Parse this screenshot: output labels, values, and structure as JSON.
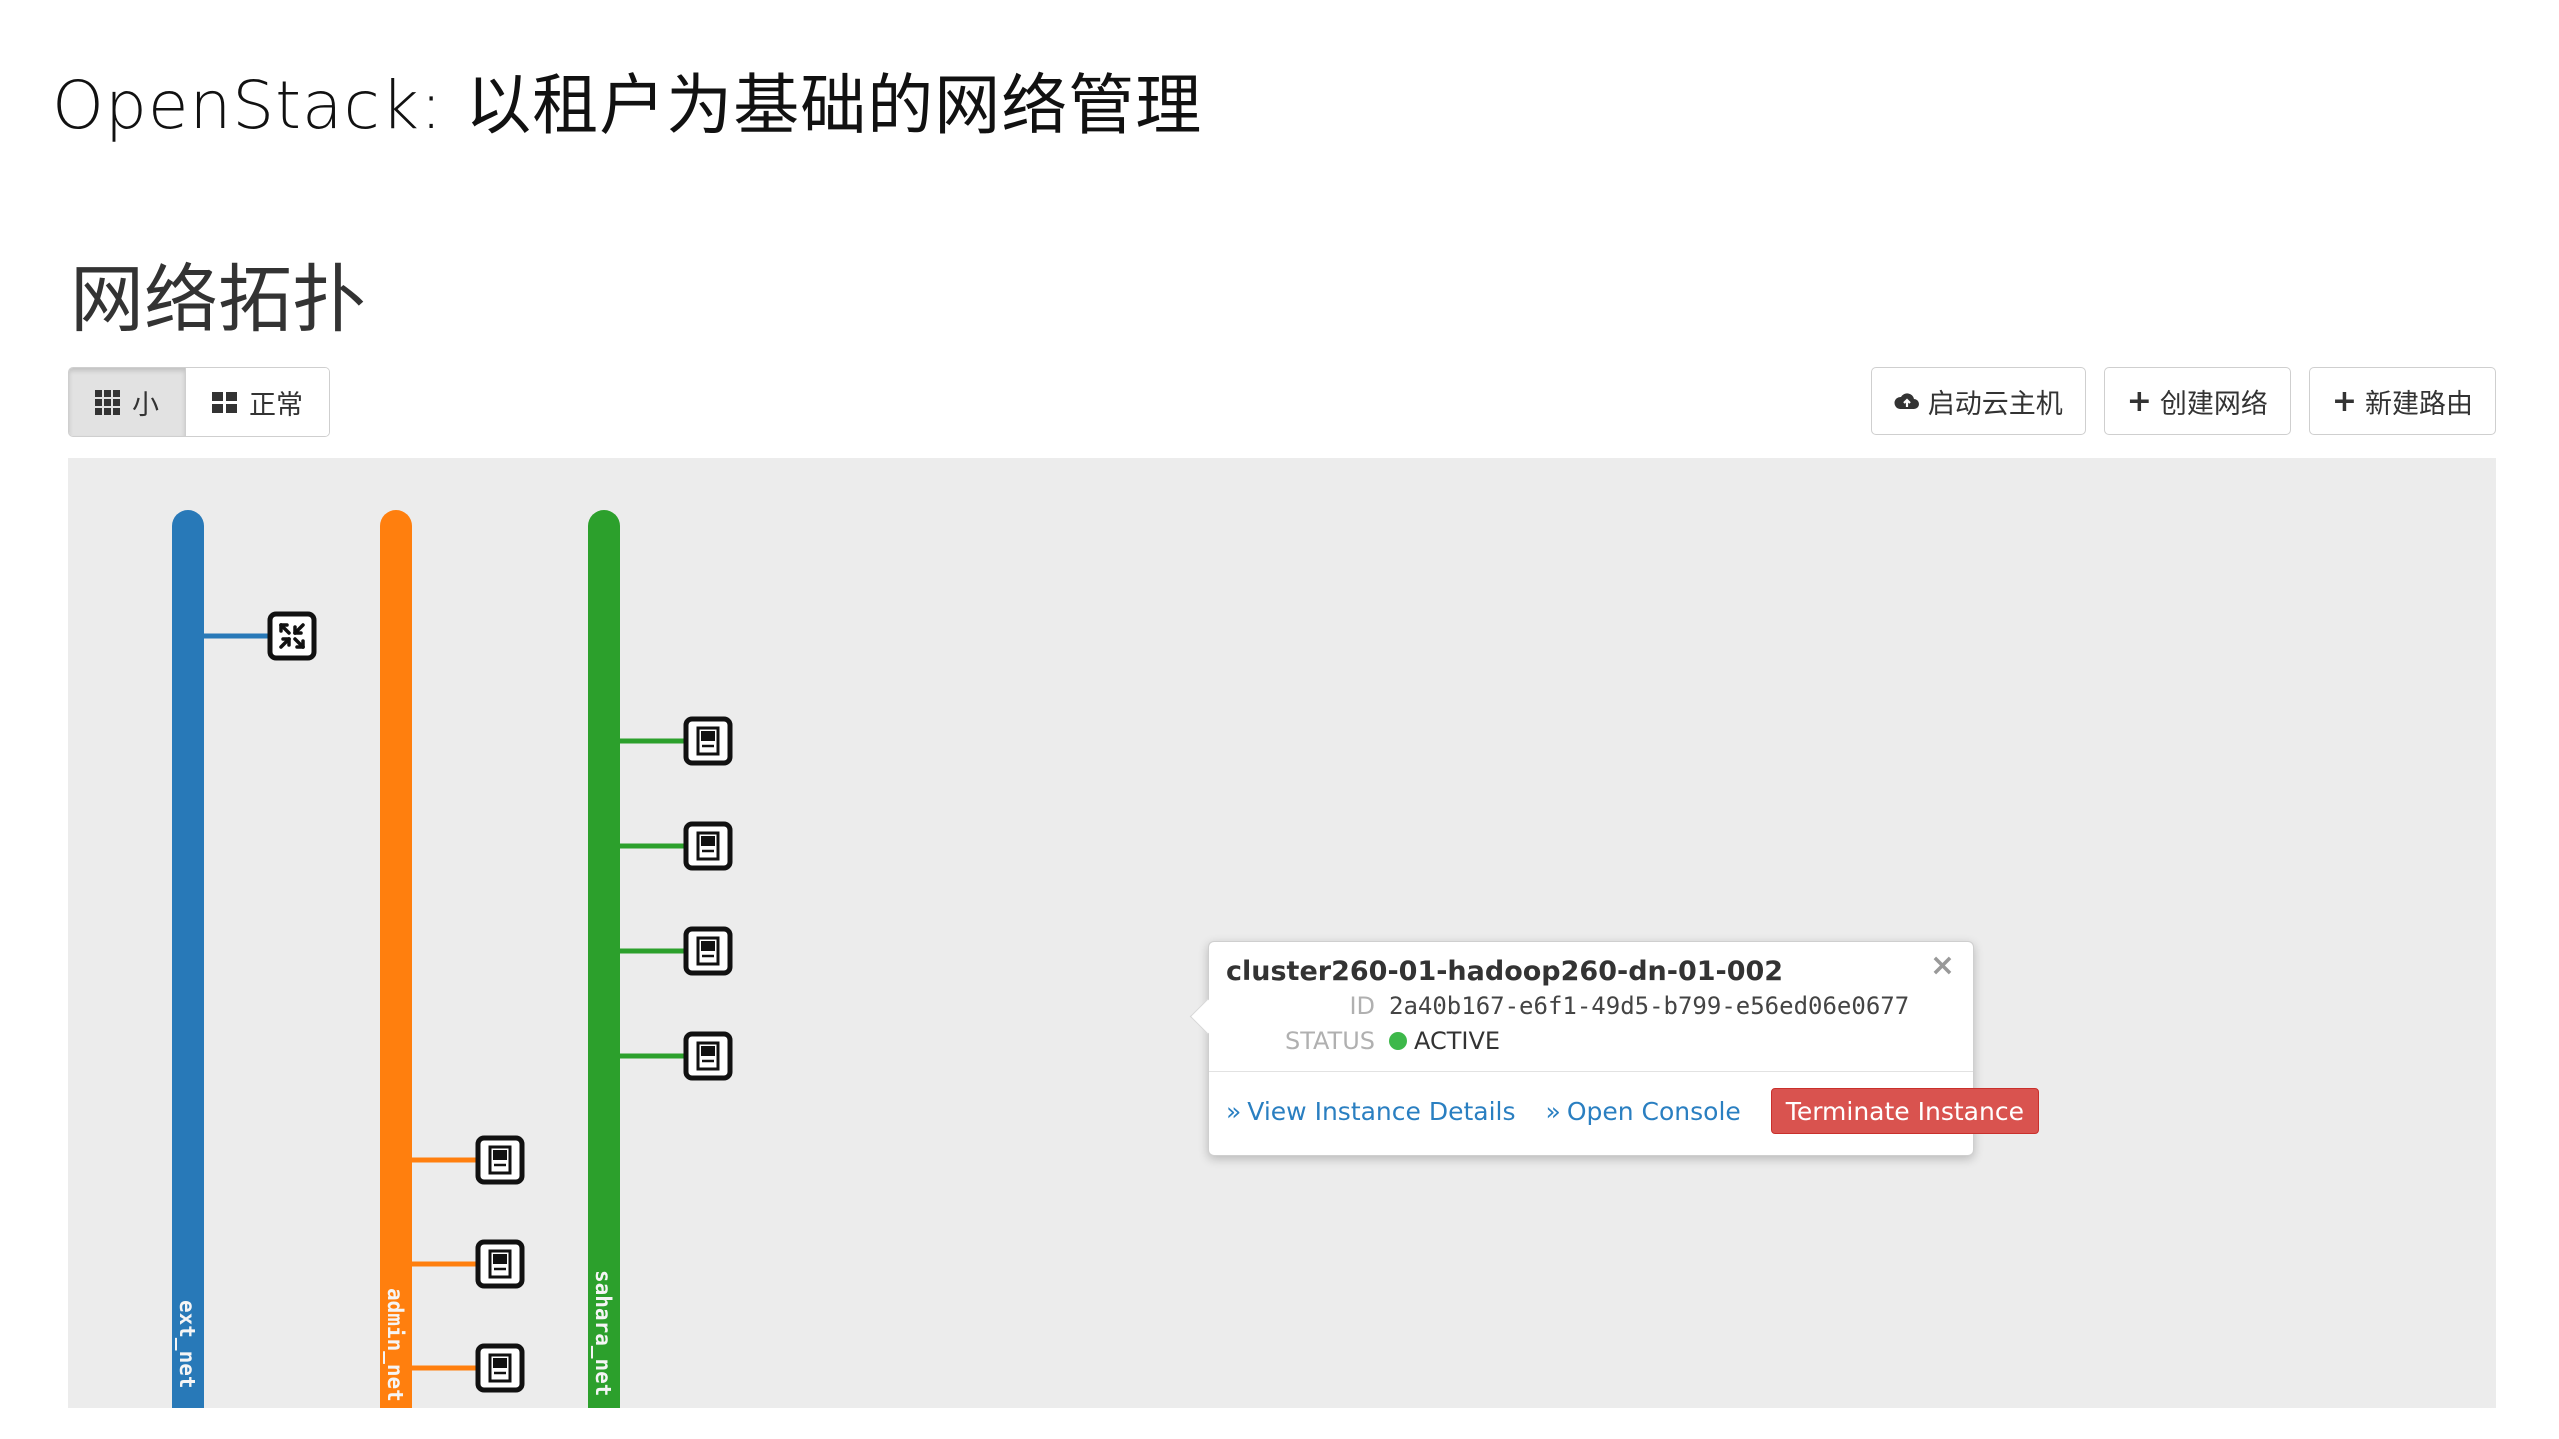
{
  "slide": {
    "title": "OpenStack: 以租户为基础的网络管理"
  },
  "page": {
    "title": "网络拓扑"
  },
  "view_toggle": {
    "small_label": "小",
    "normal_label": "正常",
    "active": "small"
  },
  "actions": {
    "launch_instance": "启动云主机",
    "create_network": "创建网络",
    "create_router": "新建路由"
  },
  "topology": {
    "networks": [
      {
        "name": "ext_net",
        "color": "#2879b8"
      },
      {
        "name": "admin_net",
        "color": "#ff7f0e"
      },
      {
        "name": "sahara_net",
        "color": "#2ca02c"
      }
    ],
    "icons": {
      "router": "router-icon",
      "instance": "server-instance-icon"
    }
  },
  "popup": {
    "instance_name": "cluster260-01-hadoop260-dn-01-002",
    "id_label": "ID",
    "id_value": "2a40b167-e6f1-49d5-b799-e56ed06e0677",
    "status_label": "STATUS",
    "status_value": "ACTIVE",
    "status_color": "#3db84a",
    "link_marker": "»",
    "view_details": "View Instance Details",
    "open_console": "Open Console",
    "terminate": "Terminate Instance",
    "close": "×"
  }
}
